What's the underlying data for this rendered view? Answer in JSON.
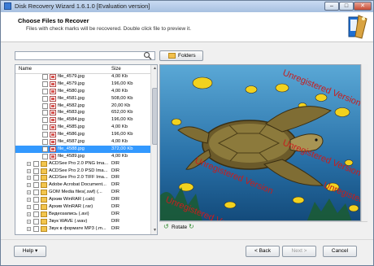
{
  "window": {
    "title": "Disk Recovery Wizard 1.6.1.0 [Evaluation version]"
  },
  "header": {
    "title": "Choose Files to Recover",
    "subtitle": "Files with check marks will be recovered. Double click file to preview it."
  },
  "toolbar": {
    "folders_label": "Folders"
  },
  "file_list": {
    "columns": {
      "name": "Name",
      "size": "Size"
    },
    "rows": [
      {
        "name": "file_4579.jpg",
        "size": "4,00 Kb",
        "type": "file"
      },
      {
        "name": "file_4579.jpg",
        "size": "196,00 Kb",
        "type": "file"
      },
      {
        "name": "file_4580.jpg",
        "size": "4,00 Kb",
        "type": "file"
      },
      {
        "name": "file_4581.jpg",
        "size": "508,00 Kb",
        "type": "file"
      },
      {
        "name": "file_4582.jpg",
        "size": "20,00 Kb",
        "type": "file"
      },
      {
        "name": "file_4583.jpg",
        "size": "652,00 Kb",
        "type": "file"
      },
      {
        "name": "file_4584.jpg",
        "size": "196,00 Kb",
        "type": "file"
      },
      {
        "name": "file_4585.jpg",
        "size": "4,00 Kb",
        "type": "file"
      },
      {
        "name": "file_4586.jpg",
        "size": "196,00 Kb",
        "type": "file"
      },
      {
        "name": "file_4587.jpg",
        "size": "4,00 Kb",
        "type": "file"
      },
      {
        "name": "file_4588.jpg",
        "size": "372,00 Kb",
        "type": "file",
        "selected": true
      },
      {
        "name": "file_4589.jpg",
        "size": "4,00 Kb",
        "type": "file"
      },
      {
        "name": "ACDSee Pro 2.0 PNG Ima...",
        "size": "DIR",
        "type": "folder"
      },
      {
        "name": "ACDSee Pro 2.0 PSD Ima...",
        "size": "DIR",
        "type": "folder"
      },
      {
        "name": "ACDSee Pro 2.0 TIFF Ima...",
        "size": "DIR",
        "type": "folder"
      },
      {
        "name": "Adobe Acrobat Document...",
        "size": "DIR",
        "type": "folder"
      },
      {
        "name": "GOM Media files(.swf) (...",
        "size": "DIR",
        "type": "folder"
      },
      {
        "name": "Архив WinRAR (.cab)",
        "size": "DIR",
        "type": "folder"
      },
      {
        "name": "Архив WinRAR (.rar)",
        "size": "DIR",
        "type": "folder"
      },
      {
        "name": "Видеозапись (.avi)",
        "size": "DIR",
        "type": "folder"
      },
      {
        "name": "Звук WAVE (.wav)",
        "size": "DIR",
        "type": "folder"
      },
      {
        "name": "Звук в формате MP3 (.m...",
        "size": "DIR",
        "type": "folder"
      }
    ]
  },
  "preview": {
    "watermark": "Unregistered Version",
    "rotate_label": "Rotate"
  },
  "buttons": {
    "help": "Help ▾",
    "back": "< Back",
    "next": "Next >",
    "cancel": "Cancel"
  },
  "colors": {
    "selection": "#3399ff",
    "watermark": "#cc1b1b",
    "water": "#2d72a8"
  }
}
